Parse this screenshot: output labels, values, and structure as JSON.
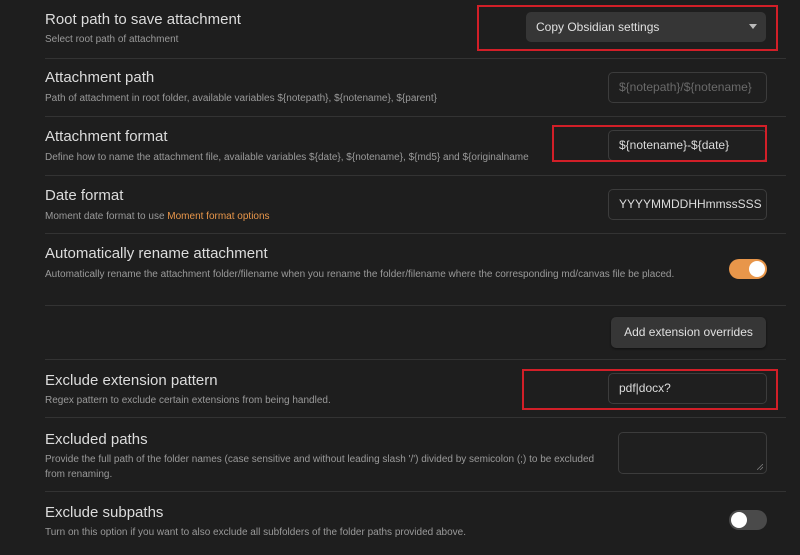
{
  "settings": {
    "root_path": {
      "name": "Root path to save attachment",
      "desc": "Select root path of attachment",
      "selected": "Copy Obsidian settings"
    },
    "attachment_path": {
      "name": "Attachment path",
      "desc": "Path of attachment in root folder, available variables ${notepath}, ${notename}, ${parent}",
      "placeholder": "${notepath}/${notename}"
    },
    "attachment_format": {
      "name": "Attachment format",
      "desc": "Define how to name the attachment file, available variables ${date}, ${notename}, ${md5} and ${originalname",
      "value": "${notename}-${date}"
    },
    "date_format": {
      "name": "Date format",
      "desc_prefix": "Moment date format to use ",
      "desc_link": "Moment format options",
      "value": "YYYYMMDDHHmmssSSS"
    },
    "auto_rename": {
      "name": "Automatically rename attachment",
      "desc": "Automatically rename the attachment folder/filename when you rename the folder/filename where the corresponding md/canvas file be placed.",
      "enabled": true
    },
    "extension_overrides": {
      "button_label": "Add extension overrides"
    },
    "exclude_extension": {
      "name": "Exclude extension pattern",
      "desc": "Regex pattern to exclude certain extensions from being handled.",
      "value": "pdf|docx?"
    },
    "excluded_paths": {
      "name": "Excluded paths",
      "desc": "Provide the full path of the folder names (case sensitive and without leading slash '/') divided by semicolon (;) to be excluded from renaming.",
      "value": ""
    },
    "exclude_subpaths": {
      "name": "Exclude subpaths",
      "desc": "Turn on this option if you want to also exclude all subfolders of the folder paths provided above.",
      "enabled": false
    }
  },
  "colors": {
    "accent": "#e8964a",
    "toggle_on": "#e8964a",
    "toggle_off": "#4a4a4a",
    "highlight": "#d21f28"
  },
  "icons": {
    "dropdown": "chevron-down-icon",
    "resize": "resize-grip-icon"
  }
}
